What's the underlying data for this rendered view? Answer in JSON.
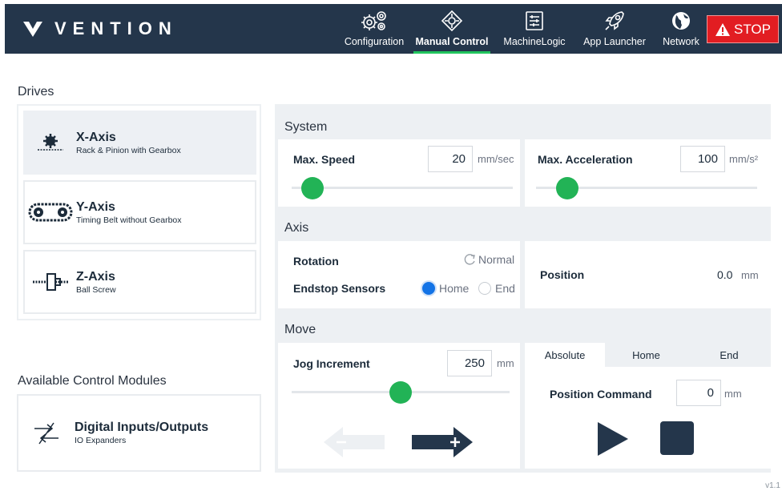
{
  "header": {
    "brand": "VENTION",
    "nav": [
      {
        "label": "Configuration",
        "icon": "gears-icon"
      },
      {
        "label": "Manual Control",
        "icon": "crosshair-move-icon",
        "active": true
      },
      {
        "label": "MachineLogic",
        "icon": "logic-board-icon"
      },
      {
        "label": "App Launcher",
        "icon": "rocket-icon"
      },
      {
        "label": "Network",
        "icon": "globe-icon"
      }
    ],
    "stop_label": "STOP"
  },
  "drives": {
    "heading": "Drives",
    "items": [
      {
        "title": "X-Axis",
        "subtitle": "Rack & Pinion with Gearbox",
        "selected": true
      },
      {
        "title": "Y-Axis",
        "subtitle": "Timing Belt without Gearbox"
      },
      {
        "title": "Z-Axis",
        "subtitle": "Ball Screw"
      }
    ]
  },
  "modules": {
    "heading": "Available Control Modules",
    "items": [
      {
        "title": "Digital Inputs/Outputs",
        "subtitle": "IO Expanders"
      }
    ]
  },
  "system": {
    "title": "System",
    "max_speed": {
      "label": "Max. Speed",
      "value": "20",
      "unit": "mm/sec",
      "slider_fraction": 0.05
    },
    "max_accel": {
      "label": "Max. Acceleration",
      "value": "100",
      "unit": "mm/s²",
      "slider_fraction": 0.1
    }
  },
  "axis": {
    "title": "Axis",
    "rotation_label": "Rotation",
    "rotation_value": "Normal",
    "endstop_label": "Endstop Sensors",
    "endstop_options": [
      "Home",
      "End"
    ],
    "endstop_selected": "Home",
    "position_label": "Position",
    "position_value": "0.0",
    "position_unit": "mm"
  },
  "move": {
    "title": "Move",
    "jog_label": "Jog Increment",
    "jog_value": "250",
    "jog_unit": "mm",
    "jog_slider_fraction": 0.5,
    "tabs": [
      "Absolute",
      "Home",
      "End"
    ],
    "active_tab": "Absolute",
    "position_command_label": "Position Command",
    "position_command_value": "0",
    "position_command_unit": "mm"
  },
  "colors": {
    "header_bg": "#24364b",
    "accent_green": "#22b356",
    "stop_red": "#e21d22",
    "radio_blue": "#1373e6"
  },
  "version": "v1.1"
}
